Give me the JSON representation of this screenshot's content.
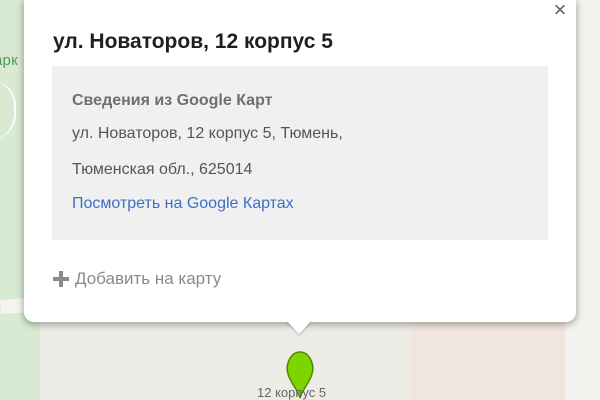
{
  "map": {
    "park_label": "арк",
    "marker_label": "12 корпус 5",
    "marker_color": "#7fd400"
  },
  "popup": {
    "title": "ул. Новаторов, 12 корпус 5",
    "close_icon": "×",
    "info": {
      "heading": "Сведения из Google Карт",
      "address_line1": "ул. Новаторов, 12 корпус 5, Тюмень,",
      "address_line2": "Тюменская обл., 625014",
      "link_label": "Посмотреть на Google Картах"
    },
    "add_label": "Добавить на карту"
  },
  "colors": {
    "link": "#3b6fc7",
    "title": "#1f1f1f",
    "info_bg": "#f0f0f0"
  }
}
